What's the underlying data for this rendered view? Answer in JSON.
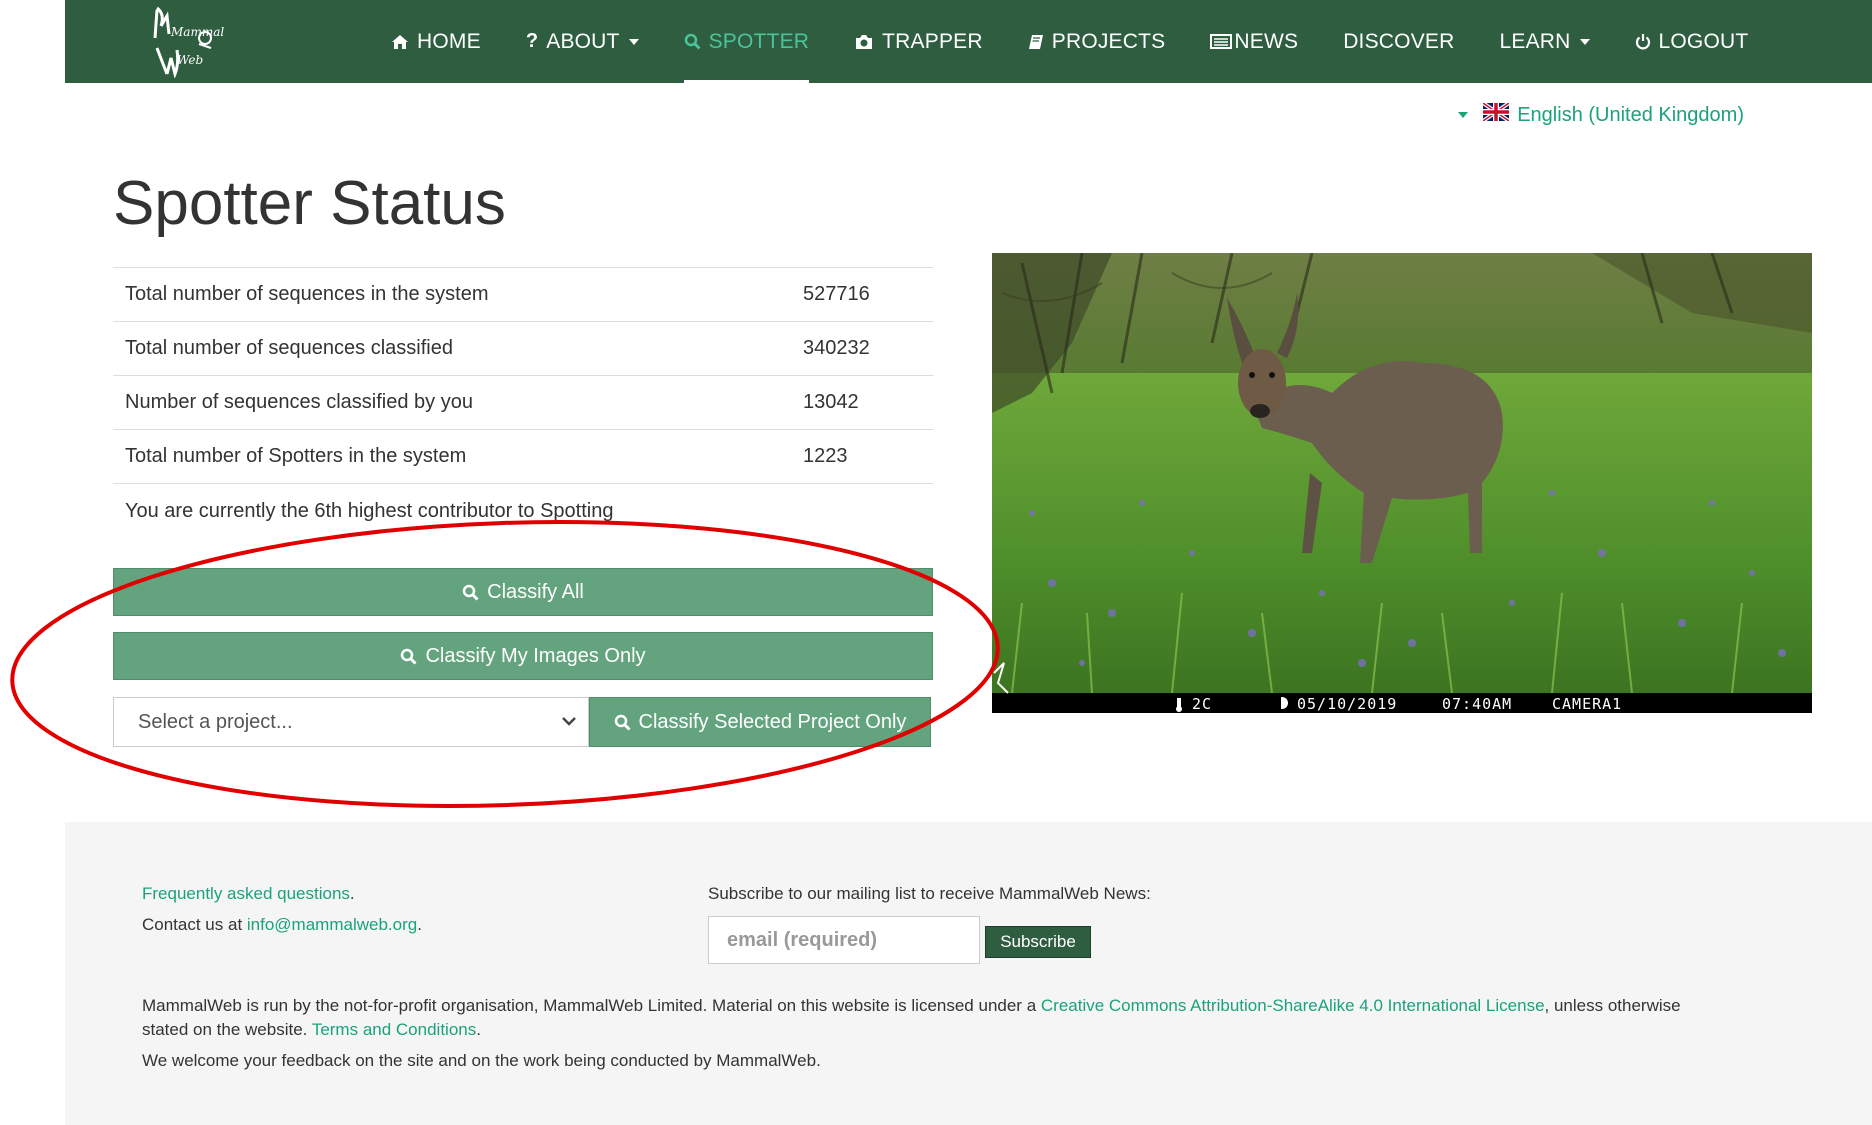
{
  "brand": {
    "logo_text_top": "Mammal",
    "logo_text_bottom": "Web"
  },
  "nav": [
    {
      "label": "HOME",
      "icon": "home-icon",
      "dropdown": false,
      "active": false
    },
    {
      "label": "ABOUT",
      "icon": "question-icon",
      "dropdown": true,
      "active": false
    },
    {
      "label": "SPOTTER",
      "icon": "search-icon",
      "dropdown": false,
      "active": true
    },
    {
      "label": "TRAPPER",
      "icon": "camera-icon",
      "dropdown": false,
      "active": false
    },
    {
      "label": "PROJECTS",
      "icon": "book-icon",
      "dropdown": false,
      "active": false
    },
    {
      "label": "NEWS",
      "icon": "newspaper-icon",
      "dropdown": false,
      "active": false
    },
    {
      "label": "DISCOVER",
      "icon": "",
      "dropdown": false,
      "active": false
    },
    {
      "label": "LEARN",
      "icon": "",
      "dropdown": true,
      "active": false
    },
    {
      "label": "LOGOUT",
      "icon": "power-icon",
      "dropdown": false,
      "active": false
    }
  ],
  "language": {
    "label": "English (United Kingdom)",
    "icon": "uk-flag-icon"
  },
  "page_title": "Spotter Status",
  "stats": [
    {
      "label": "Total number of sequences in the system",
      "value": "527716"
    },
    {
      "label": "Total number of sequences classified",
      "value": "340232"
    },
    {
      "label": "Number of sequences classified by you",
      "value": "13042"
    },
    {
      "label": "Total number of Spotters in the system",
      "value": "1223"
    }
  ],
  "contributor_text": "You are currently the 6th highest contributor to Spotting",
  "buttons": {
    "classify_all": "Classify All",
    "classify_mine": "Classify My Images Only",
    "classify_selected": "Classify Selected Project Only"
  },
  "project_select": {
    "placeholder": "Select a project..."
  },
  "camera_overlay": {
    "temp": "2C",
    "date": "05/10/2019",
    "time": "07:40AM",
    "camera": "CAMERA1"
  },
  "footer": {
    "faq": "Frequently asked questions",
    "contact_prefix": "Contact us at ",
    "contact_email": "info@mammalweb.org",
    "subscribe_text": "Subscribe to our mailing list to receive MammalWeb News:",
    "email_placeholder": "email (required)",
    "subscribe_button": "Subscribe",
    "license_prefix": "MammalWeb is run by the not-for-profit organisation, MammalWeb Limited. Material on this website is licensed under a ",
    "license_link": "Creative Commons Attribution-ShareAlike 4.0 International License",
    "license_suffix": ", unless otherwise",
    "license_line2": "stated on the website. ",
    "terms_link": "Terms and Conditions",
    "feedback": "We welcome your feedback on the site and on the work being conducted by MammalWeb."
  },
  "colors": {
    "nav_bg": "#2f5d3f",
    "accent": "#1aa37a",
    "button": "#63a47e",
    "annotation": "#e10000"
  }
}
